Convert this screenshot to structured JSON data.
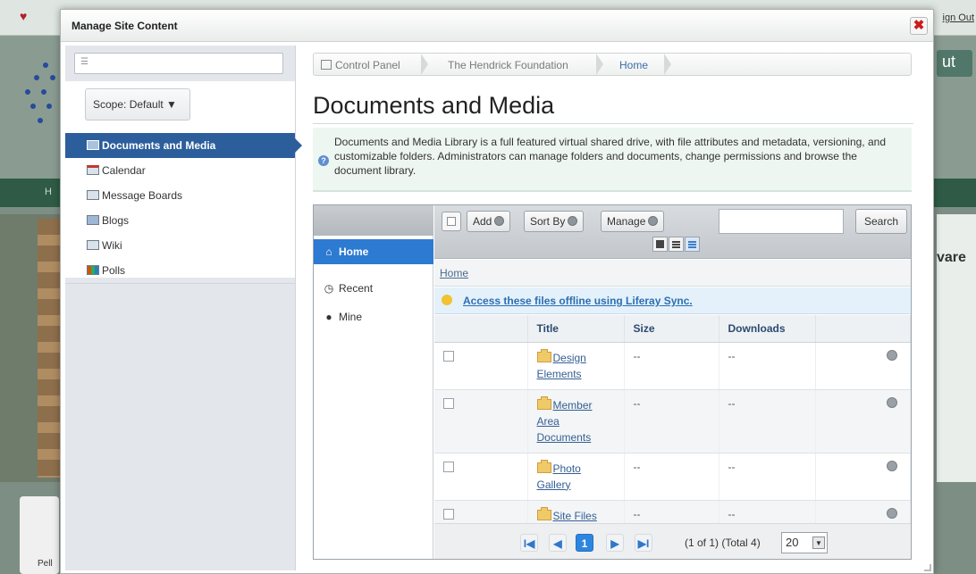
{
  "background": {
    "sign_out": "ign Out",
    "logo_glyph": "♥",
    "ut_text": "ut",
    "nav_letter": "H",
    "right_text": "vare",
    "bottom_text": "Pell"
  },
  "modal": {
    "title": "Manage Site Content",
    "close_glyph": "✖"
  },
  "left_panel": {
    "search_value": "",
    "scope_label": "Scope: Default ▼",
    "items": [
      {
        "label": "Documents and Media",
        "active": true
      },
      {
        "label": "Calendar"
      },
      {
        "label": "Message Boards"
      },
      {
        "label": "Blogs"
      },
      {
        "label": "Wiki"
      },
      {
        "label": "Polls"
      }
    ]
  },
  "breadcrumb": {
    "items": [
      "Control Panel",
      "The Hendrick Foundation",
      "Home"
    ]
  },
  "page": {
    "title": "Documents and Media",
    "info_icon": "?",
    "description": "Documents and Media Library is a full featured virtual shared drive, with file attributes and metadata, versioning, and customizable folders. Administrators can manage folders and documents, change permissions and browse the document library."
  },
  "library": {
    "nav": {
      "home": "Home",
      "recent": "Recent",
      "mine": "Mine"
    },
    "toolbar": {
      "add": "Add",
      "sort_by": "Sort By",
      "manage": "Manage",
      "search_value": "",
      "search_button": "Search"
    },
    "current_folder": "Home",
    "sync_message": "Access these files offline using Liferay Sync.",
    "columns": [
      "Title",
      "Size",
      "Downloads"
    ],
    "rows": [
      {
        "title": "Design Elements",
        "size": "--",
        "downloads": "--"
      },
      {
        "title": "Member Area Documents",
        "size": "--",
        "downloads": "--"
      },
      {
        "title": "Photo Gallery",
        "size": "--",
        "downloads": "--"
      },
      {
        "title": "Site Files",
        "size": "--",
        "downloads": "--"
      }
    ],
    "pager": {
      "first": "I◀",
      "prev": "◀",
      "current": "1",
      "next": "▶",
      "last": "▶I",
      "status": "(1 of 1) (Total 4)",
      "page_size": "20"
    }
  }
}
